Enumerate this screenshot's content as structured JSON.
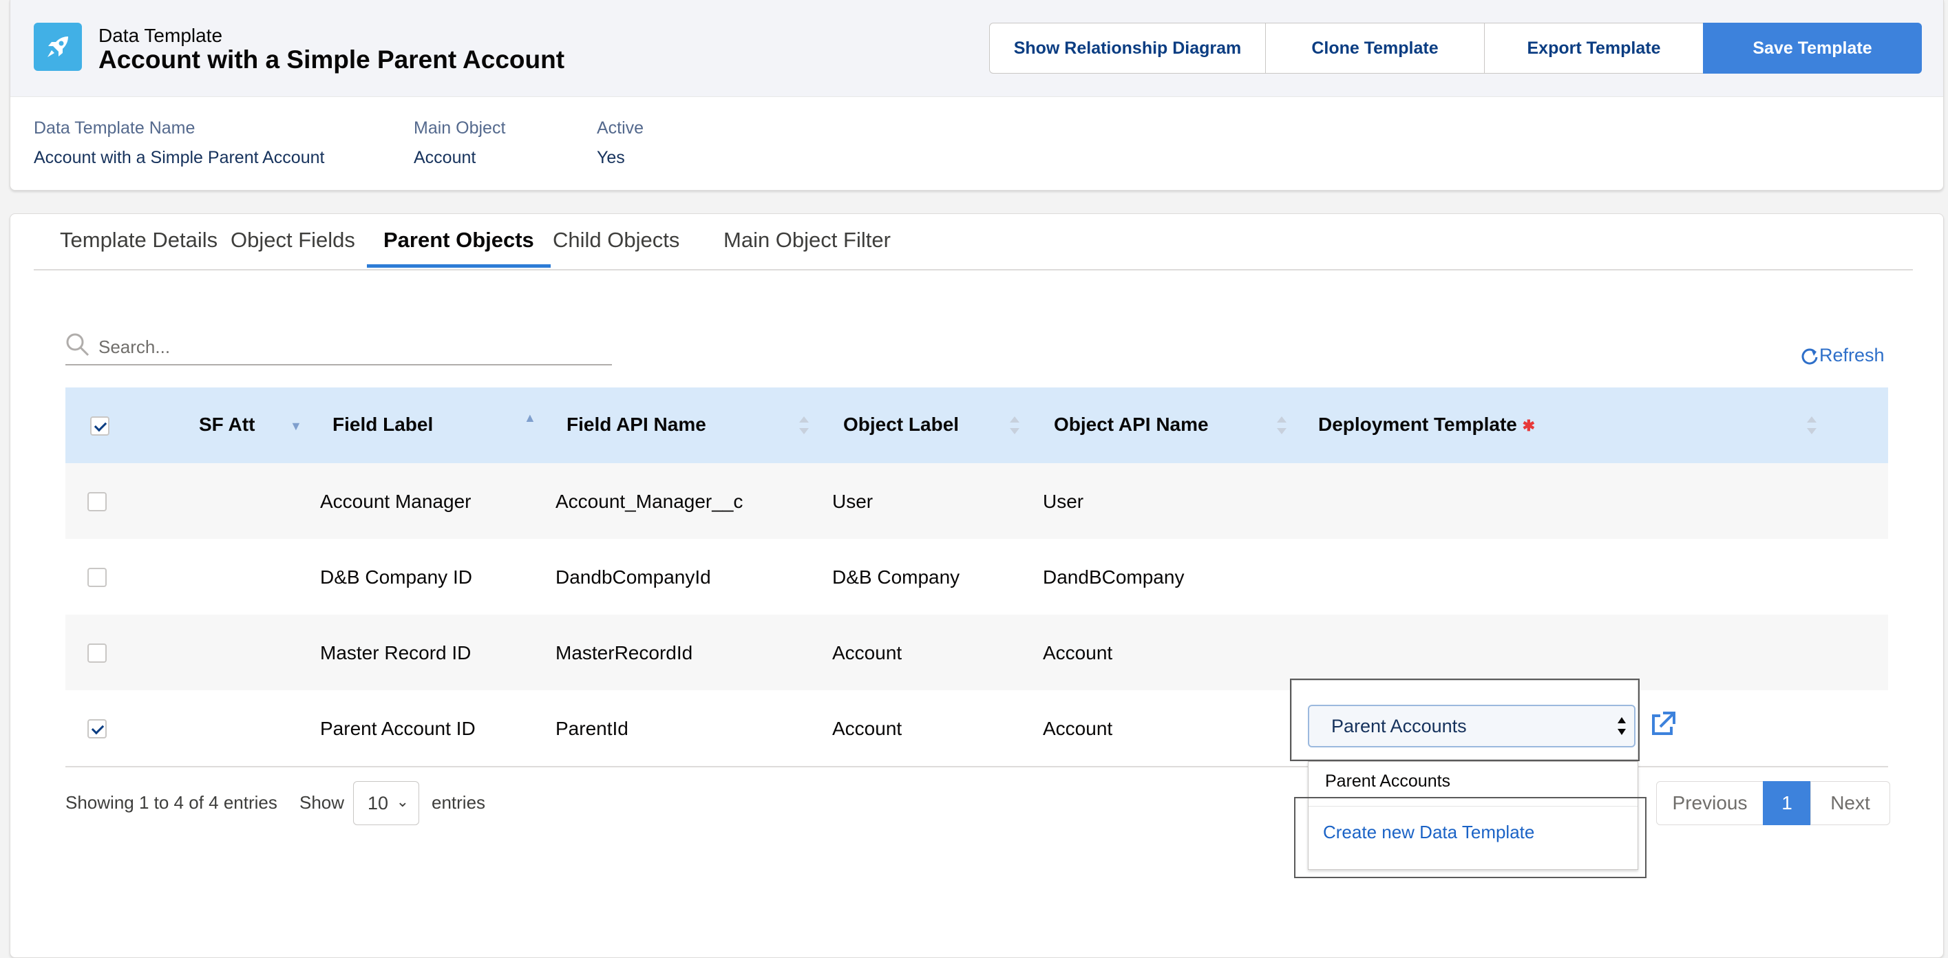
{
  "header": {
    "object_type": "Data Template",
    "record_title": "Account with a Simple Parent Account",
    "buttons": {
      "show_diagram": "Show Relationship Diagram",
      "clone": "Clone Template",
      "export": "Export Template",
      "save": "Save Template"
    },
    "fields": [
      {
        "label": "Data Template Name",
        "value": "Account with a Simple Parent Account"
      },
      {
        "label": "Main Object",
        "value": "Account"
      },
      {
        "label": "Active",
        "value": "Yes"
      }
    ]
  },
  "tabs": [
    {
      "label": "Template Details",
      "active": false
    },
    {
      "label": "Object Fields",
      "active": false
    },
    {
      "label": "Parent Objects",
      "active": true
    },
    {
      "label": "Child Objects",
      "active": false
    },
    {
      "label": "Main Object Filter",
      "active": false
    }
  ],
  "search": {
    "placeholder": "Search..."
  },
  "refresh_label": "Refresh",
  "table": {
    "headers": {
      "sf_att": "SF Att",
      "field_label": "Field Label",
      "field_api": "Field API Name",
      "object_label": "Object Label",
      "object_api": "Object API Name",
      "deployment": "Deployment Template",
      "required_mark": "✱"
    },
    "header_checked": true,
    "rows": [
      {
        "checked": false,
        "field_label": "Account Manager",
        "field_api": "Account_Manager__c",
        "object_label": "User",
        "object_api": "User"
      },
      {
        "checked": false,
        "field_label": "D&B Company ID",
        "field_api": "DandbCompanyId",
        "object_label": "D&B Company",
        "object_api": "DandBCompany"
      },
      {
        "checked": false,
        "field_label": "Master Record ID",
        "field_api": "MasterRecordId",
        "object_label": "Account",
        "object_api": "Account"
      },
      {
        "checked": true,
        "field_label": "Parent Account ID",
        "field_api": "ParentId",
        "object_label": "Account",
        "object_api": "Account"
      }
    ]
  },
  "footer": {
    "showing": "Showing 1 to 4 of 4 entries",
    "show": "Show",
    "page_size": "10",
    "entries": "entries",
    "pager": {
      "previous": "Previous",
      "current": "1",
      "next": "Next"
    }
  },
  "deployment_select": {
    "value": "Parent Accounts",
    "options": [
      "Parent Accounts"
    ],
    "create_new": "Create new Data Template"
  },
  "colors": {
    "brand": "#3d82dc",
    "header_row": "#d8e9fa",
    "app_icon": "#41b0e6"
  }
}
